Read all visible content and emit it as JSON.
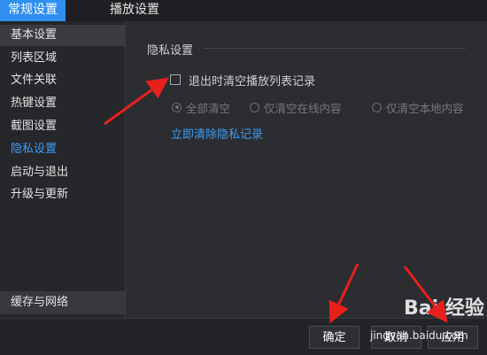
{
  "tabs": [
    {
      "label": "常规设置",
      "active": true
    },
    {
      "label": "播放设置",
      "active": false
    }
  ],
  "sidebar": {
    "items": [
      {
        "label": "基本设置"
      },
      {
        "label": "列表区域"
      },
      {
        "label": "文件关联"
      },
      {
        "label": "热键设置"
      },
      {
        "label": "截图设置"
      },
      {
        "label": "隐私设置",
        "active": true
      },
      {
        "label": "启动与退出"
      },
      {
        "label": "升级与更新"
      }
    ],
    "bottom_item": "缓存与网络"
  },
  "privacy": {
    "section_title": "隐私设置",
    "clear_on_exit": {
      "label": "退出时清空播放列表记录",
      "checked": false
    },
    "radio_options": [
      {
        "label": "全部清空",
        "checked": true
      },
      {
        "label": "仅清空在线内容",
        "checked": false
      },
      {
        "label": "仅清空本地内容",
        "checked": false
      }
    ],
    "clear_now_link": "立即清除隐私记录"
  },
  "footer": {
    "ok": "确定",
    "cancel": "取消",
    "apply": "应用"
  },
  "watermark": {
    "main": "Bai 经验",
    "sub": "jingyan.baidu.com"
  },
  "colors": {
    "accent": "#2e8ff0",
    "link": "#3c9df5",
    "arrow": "#e8201c",
    "background": "#2b2d31"
  }
}
